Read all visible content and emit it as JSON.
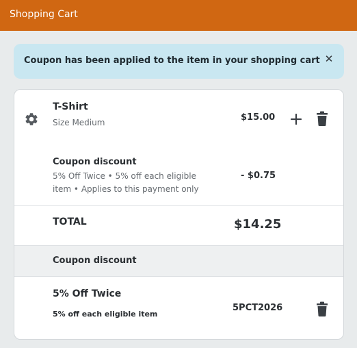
{
  "header": {
    "title": "Shopping Cart"
  },
  "alert": {
    "message": "Coupon has been applied to the item in your shopping cart",
    "close_glyph": "✕"
  },
  "cart": {
    "item": {
      "name": "T-Shirt",
      "variant": "Size Medium",
      "price": "$15.00",
      "icon": "gear-icon"
    },
    "discount": {
      "title": "Coupon discount",
      "description": "5% Off Twice • 5% off each eligible item • Applies to this payment only",
      "amount": "- $0.75"
    },
    "total": {
      "label": "TOTAL",
      "value": "$14.25"
    },
    "coupon_section": {
      "heading": "Coupon discount",
      "name": "5% Off Twice",
      "description": "5% off each eligible item",
      "code": "5PCT2026"
    }
  },
  "colors": {
    "header": "#d06712",
    "alert_bg": "#c9e7f1",
    "page_bg": "#e8ebec"
  }
}
